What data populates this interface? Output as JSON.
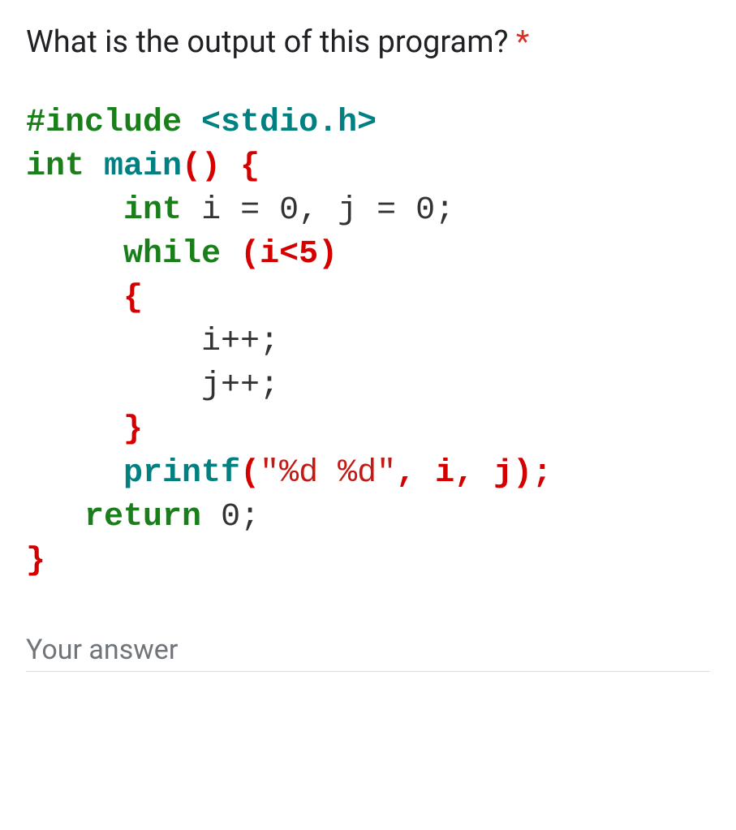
{
  "question": {
    "text": "What is the output of this program?",
    "required_marker": "*"
  },
  "code": {
    "l1": {
      "kw": "#include",
      "hdr": "<stdio.h>"
    },
    "l2": {
      "t1": "int",
      "fn": "main",
      "p": "()",
      "br": "{"
    },
    "l3": {
      "t1": "int",
      "rest": "i = 0, j = 0;"
    },
    "l4": {
      "kw": "while",
      "cond": "(i<5)"
    },
    "l5": {
      "br": "{"
    },
    "l6": {
      "txt": "i++;"
    },
    "l7": {
      "txt": "j++;"
    },
    "l8": {
      "br": "}"
    },
    "l9": {
      "fn": "printf",
      "p1": "(",
      "str": "\"%d %d\"",
      "p2": ", i, j);"
    },
    "l10": {
      "kw": "return",
      "n": "0;"
    },
    "l11": {
      "br": "}"
    }
  },
  "answer": {
    "placeholder": "Your answer"
  }
}
